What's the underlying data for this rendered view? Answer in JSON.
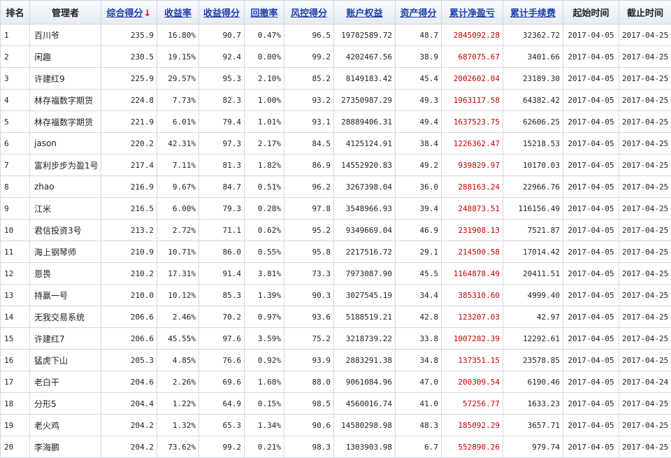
{
  "headers": [
    "排名",
    "管理者",
    "综合得分",
    "收益率",
    "收益得分",
    "回撤率",
    "风控得分",
    "账户权益",
    "资产得分",
    "累计净盈亏",
    "累计手续费",
    "起始时间",
    "截止时间"
  ],
  "sort_arrow": "↓",
  "rows": [
    [
      "1",
      "百川爷",
      "235.9",
      "16.80%",
      "90.7",
      "0.47%",
      "96.5",
      "19782589.72",
      "48.7",
      "2845092.28",
      "32362.72",
      "2017-04-05",
      "2017-04-25"
    ],
    [
      "2",
      "闲趣",
      "230.5",
      "19.15%",
      "92.4",
      "0.00%",
      "99.2",
      "4202467.56",
      "38.9",
      "687075.67",
      "3401.66",
      "2017-04-05",
      "2017-04-25"
    ],
    [
      "3",
      "许建红9",
      "225.9",
      "29.57%",
      "95.3",
      "2.10%",
      "85.2",
      "8149183.42",
      "45.4",
      "2002602.04",
      "23189.30",
      "2017-04-05",
      "2017-04-25"
    ],
    [
      "4",
      "林存福数字期货",
      "224.8",
      "7.73%",
      "82.3",
      "1.00%",
      "93.2",
      "27350987.29",
      "49.3",
      "1963117.58",
      "64382.42",
      "2017-04-05",
      "2017-04-25"
    ],
    [
      "5",
      "林存福数字期货",
      "221.9",
      "6.01%",
      "79.4",
      "1.01%",
      "93.1",
      "28889406.31",
      "49.4",
      "1637523.75",
      "62606.25",
      "2017-04-05",
      "2017-04-25"
    ],
    [
      "6",
      "jason",
      "220.2",
      "42.31%",
      "97.3",
      "2.17%",
      "84.5",
      "4125124.91",
      "38.4",
      "1226362.47",
      "15218.53",
      "2017-04-05",
      "2017-04-25"
    ],
    [
      "7",
      "富利步步为盈1号",
      "217.4",
      "7.11%",
      "81.3",
      "1.82%",
      "86.9",
      "14552920.83",
      "49.2",
      "939829.97",
      "10170.03",
      "2017-04-05",
      "2017-04-25"
    ],
    [
      "8",
      "zhao",
      "216.9",
      "9.67%",
      "84.7",
      "0.51%",
      "96.2",
      "3267398.04",
      "36.0",
      "288163.24",
      "22966.76",
      "2017-04-05",
      "2017-04-25"
    ],
    [
      "9",
      "江米",
      "216.5",
      "6.00%",
      "79.3",
      "0.28%",
      "97.8",
      "3548966.93",
      "39.4",
      "248873.51",
      "116156.49",
      "2017-04-05",
      "2017-04-25"
    ],
    [
      "10",
      "君信投资3号",
      "213.2",
      "2.72%",
      "71.1",
      "0.62%",
      "95.2",
      "9349669.04",
      "46.9",
      "231908.13",
      "7521.87",
      "2017-04-05",
      "2017-04-25"
    ],
    [
      "11",
      "海上钢琴师",
      "210.9",
      "10.71%",
      "86.0",
      "0.55%",
      "95.8",
      "2217516.72",
      "29.1",
      "214500.58",
      "17014.42",
      "2017-04-05",
      "2017-04-25"
    ],
    [
      "12",
      "恩畏",
      "210.2",
      "17.31%",
      "91.4",
      "3.81%",
      "73.3",
      "7973087.90",
      "45.5",
      "1164878.49",
      "20411.51",
      "2017-04-05",
      "2017-04-25"
    ],
    [
      "13",
      "持赢一号",
      "210.0",
      "10.12%",
      "85.3",
      "1.39%",
      "90.3",
      "3027545.19",
      "34.4",
      "385310.60",
      "4999.40",
      "2017-04-05",
      "2017-04-25"
    ],
    [
      "14",
      "无我交易系统",
      "206.6",
      "2.46%",
      "70.2",
      "0.97%",
      "93.6",
      "5188519.21",
      "42.8",
      "123207.03",
      "42.97",
      "2017-04-05",
      "2017-04-25"
    ],
    [
      "15",
      "许建红7",
      "206.6",
      "45.55%",
      "97.6",
      "3.59%",
      "75.2",
      "3218739.22",
      "33.8",
      "1007282.39",
      "12292.61",
      "2017-04-05",
      "2017-04-25"
    ],
    [
      "16",
      "猛虎下山",
      "205.3",
      "4.85%",
      "76.6",
      "0.92%",
      "93.9",
      "2883291.38",
      "34.8",
      "137351.15",
      "23578.85",
      "2017-04-05",
      "2017-04-25"
    ],
    [
      "17",
      "老白干",
      "204.6",
      "2.26%",
      "69.6",
      "1.68%",
      "88.0",
      "9061084.96",
      "47.0",
      "200309.54",
      "6190.46",
      "2017-04-05",
      "2017-04-24"
    ],
    [
      "18",
      "分形5",
      "204.4",
      "1.22%",
      "64.9",
      "0.15%",
      "98.5",
      "4560016.74",
      "41.0",
      "57256.77",
      "1633.23",
      "2017-04-05",
      "2017-04-25"
    ],
    [
      "19",
      "老火鸡",
      "204.2",
      "1.32%",
      "65.3",
      "1.34%",
      "90.6",
      "14580298.98",
      "48.3",
      "185092.29",
      "3657.71",
      "2017-04-05",
      "2017-04-25"
    ],
    [
      "20",
      "李海鹏",
      "204.2",
      "73.62%",
      "99.2",
      "0.21%",
      "98.3",
      "1303903.98",
      "6.7",
      "552890.26",
      "979.74",
      "2017-04-05",
      "2017-04-25"
    ]
  ]
}
